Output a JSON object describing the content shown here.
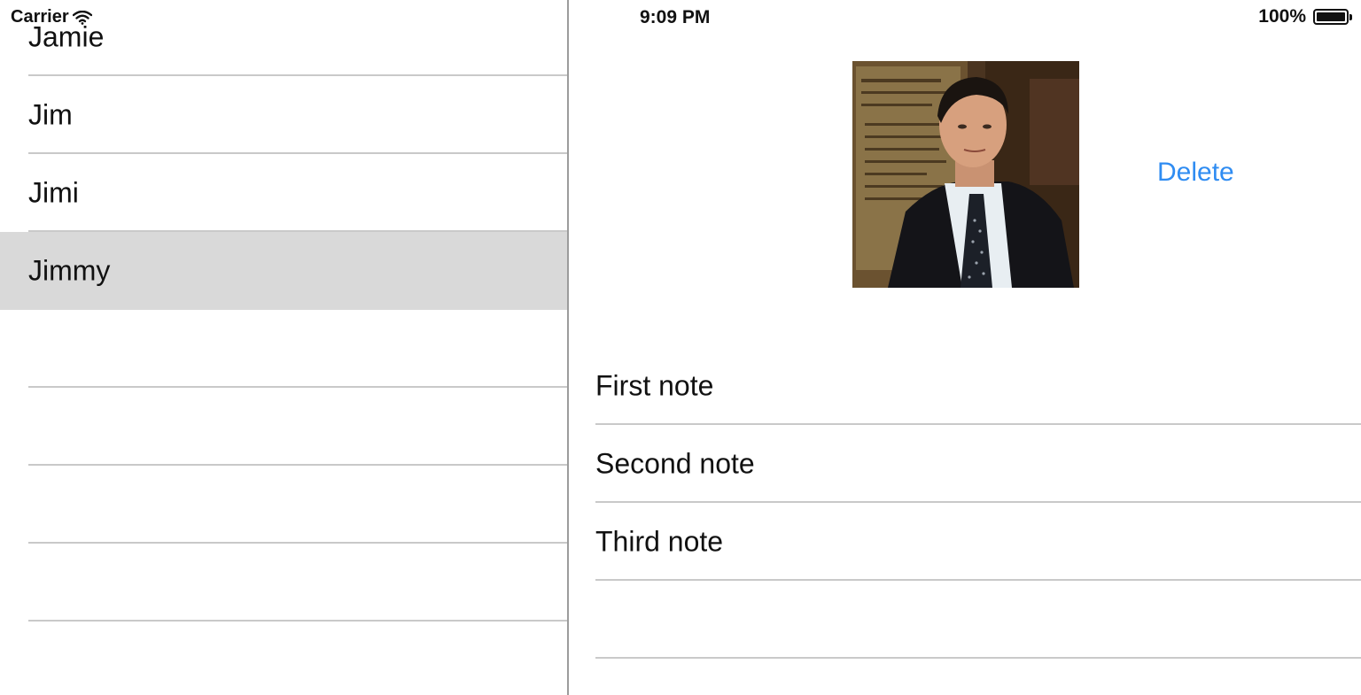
{
  "status_bar": {
    "carrier": "Carrier",
    "time": "9:09 PM",
    "battery": "100%",
    "battery_level": 1.0,
    "wifi_icon": "wifi-icon",
    "battery_icon": "battery-icon"
  },
  "master_list": {
    "items": [
      {
        "label": "Jamie",
        "selected": false
      },
      {
        "label": "Jim",
        "selected": false
      },
      {
        "label": "Jimi",
        "selected": false
      },
      {
        "label": "Jimmy",
        "selected": true
      },
      {
        "label": "",
        "selected": false
      },
      {
        "label": "",
        "selected": false
      },
      {
        "label": "",
        "selected": false
      },
      {
        "label": "",
        "selected": false
      }
    ]
  },
  "detail": {
    "photo_icon": "contact-photo",
    "delete_label": "Delete",
    "notes": [
      {
        "label": "First note"
      },
      {
        "label": "Second note"
      },
      {
        "label": "Third note"
      },
      {
        "label": ""
      }
    ]
  },
  "colors": {
    "accent": "#2f8cf2",
    "selected_row": "#d9d9d9",
    "separator": "#c9c9c9"
  }
}
